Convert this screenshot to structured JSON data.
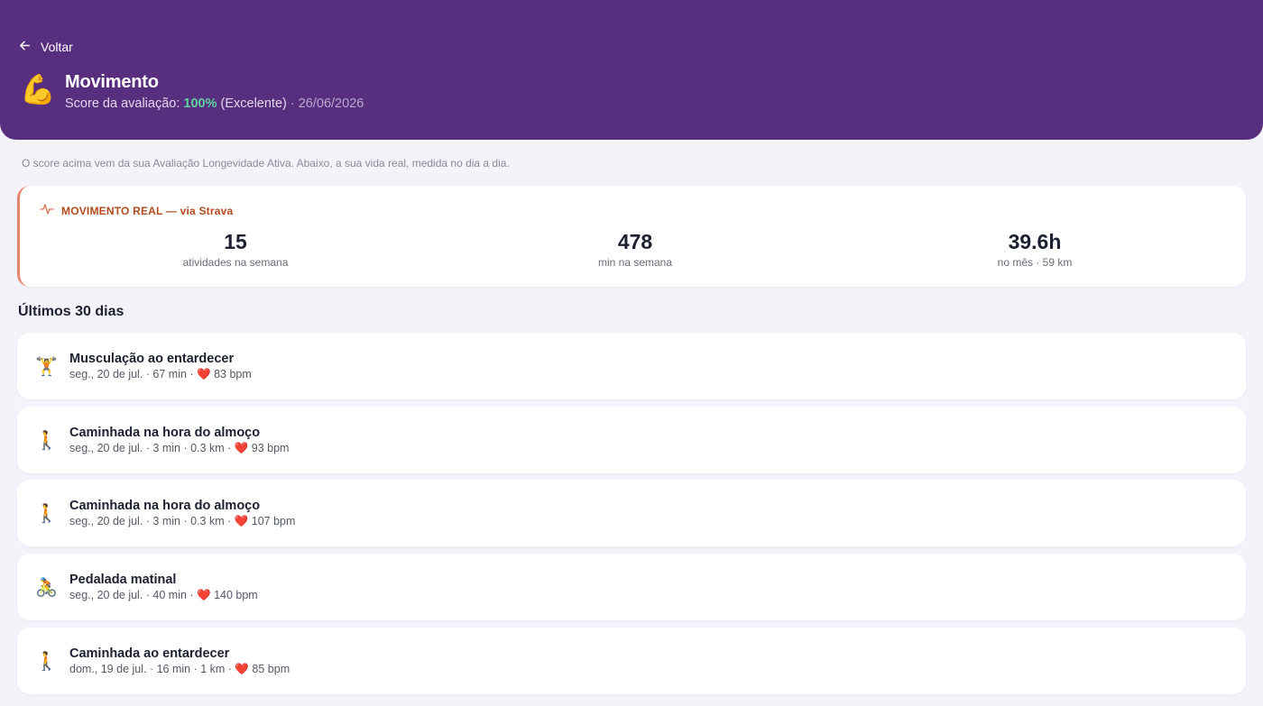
{
  "header": {
    "back_label": "Voltar",
    "emoji": "💪",
    "title": "Movimento",
    "score_prefix": "Score da avaliação:",
    "score_value": "100%",
    "score_rating": "(Excelente)",
    "score_date": "· 26/06/2026"
  },
  "note": "O score acima vem da sua Avaliação Longevidade Ativa. Abaixo, a sua vida real, medida no dia a dia.",
  "strava": {
    "label": "MOVIMENTO REAL — via Strava",
    "stats": [
      {
        "value": "15",
        "label": "atividades na semana"
      },
      {
        "value": "478",
        "label": "min na semana"
      },
      {
        "value": "39.6h",
        "label": "no mês · 59 km"
      }
    ]
  },
  "section_title": "Últimos 30 dias",
  "activities": [
    {
      "emoji": "🏋️",
      "name": "Musculação ao entardecer",
      "meta": "seg., 20 de jul. · 67 min · ❤️ 83 bpm"
    },
    {
      "emoji": "🚶",
      "name": "Caminhada na hora do almoço",
      "meta": "seg., 20 de jul. · 3 min · 0.3 km · ❤️ 93 bpm"
    },
    {
      "emoji": "🚶",
      "name": "Caminhada na hora do almoço",
      "meta": "seg., 20 de jul. · 3 min · 0.3 km · ❤️ 107 bpm"
    },
    {
      "emoji": "🚴",
      "name": "Pedalada matinal",
      "meta": "seg., 20 de jul. · 40 min · ❤️ 140 bpm"
    },
    {
      "emoji": "🚶",
      "name": "Caminhada ao entardecer",
      "meta": "dom., 19 de jul. · 16 min · 1 km · ❤️ 85 bpm"
    }
  ],
  "colors": {
    "header_bg": "#582e7e",
    "score_green": "#5dd39e",
    "strava_accent": "#e8836c"
  }
}
